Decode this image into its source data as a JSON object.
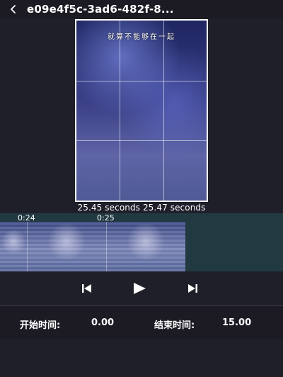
{
  "header": {
    "title": "e09e4f5c-3ad6-482f-8...",
    "back_icon": "chevron-left-icon"
  },
  "preview": {
    "overlay_text": "就算不能够在一起",
    "time_readout": "25.45 seconds 25.47 seconds"
  },
  "timeline": {
    "ticks": [
      "0:24",
      "0:25"
    ]
  },
  "controls": {
    "previous_icon": "skip-previous-icon",
    "play_icon": "play-icon",
    "next_icon": "skip-next-icon"
  },
  "info": {
    "start_label": "开始时间:",
    "start_value": "0.00",
    "end_label": "结束时间:",
    "end_value": "15.00"
  },
  "colors": {
    "background": "#1f1f2a",
    "header": "#1c1b24",
    "timeline": "#213a42"
  }
}
